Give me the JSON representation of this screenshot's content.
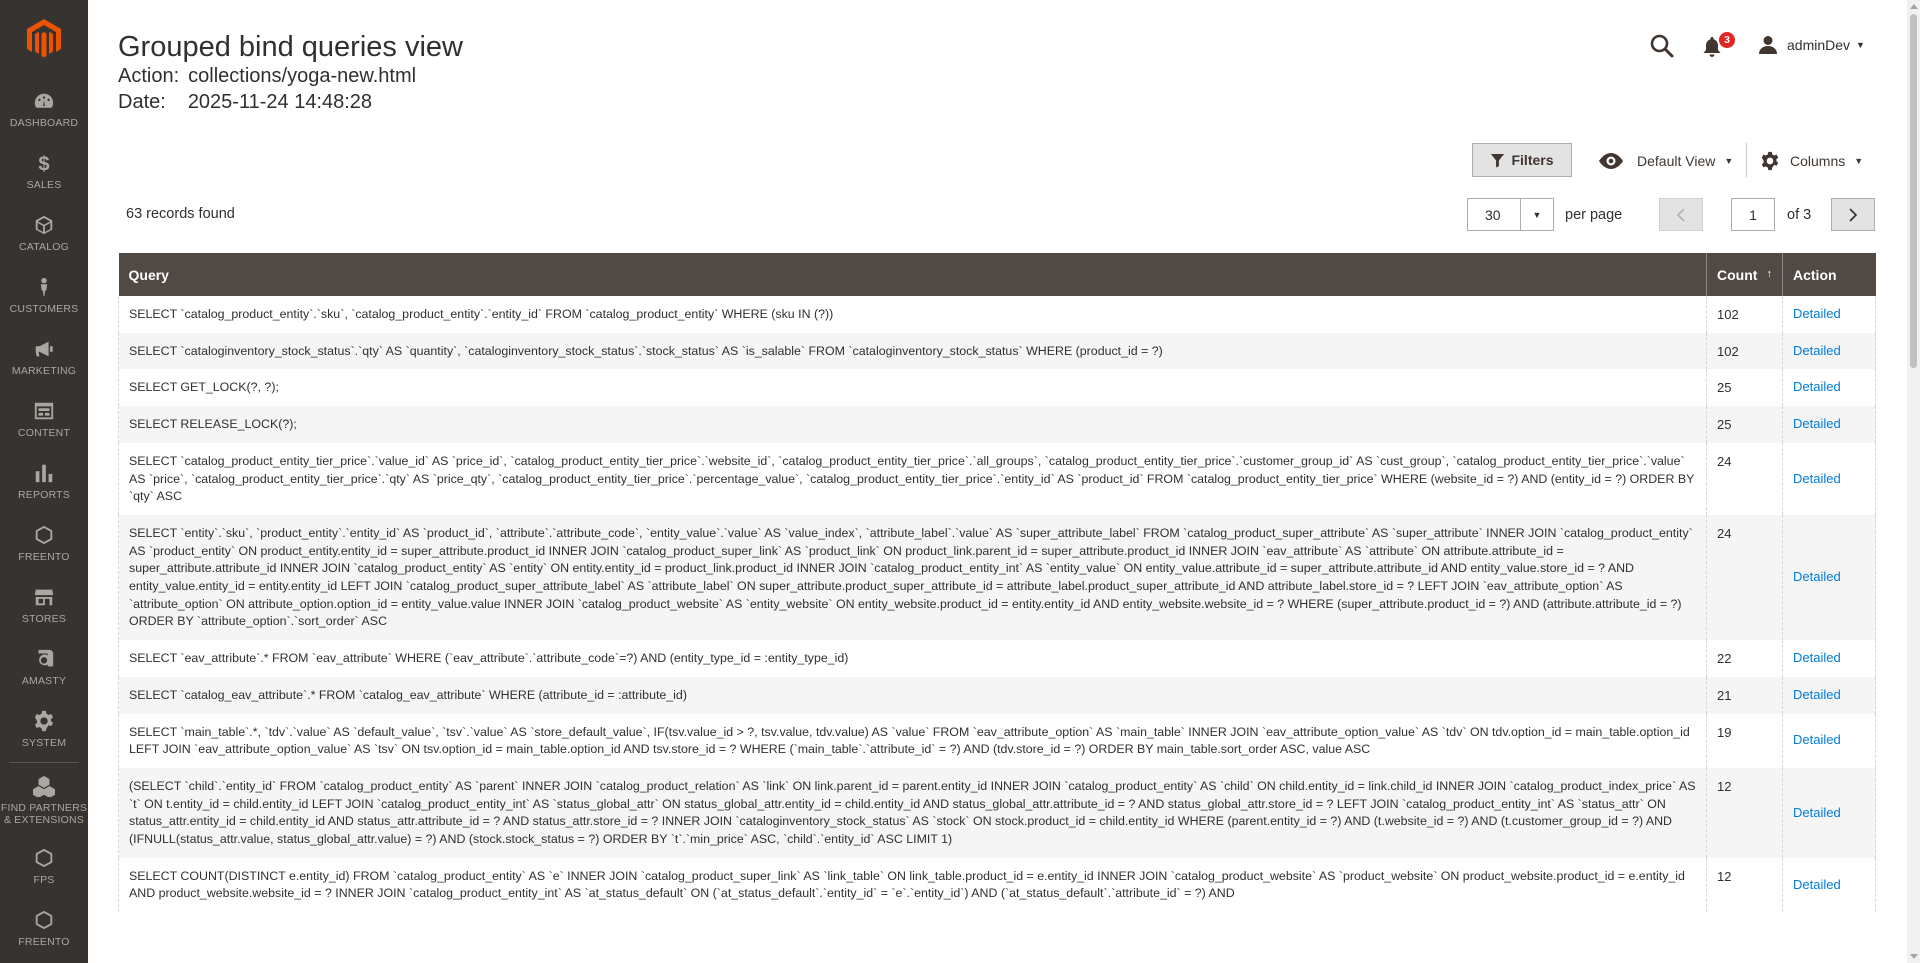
{
  "sidebar": {
    "logo": "magento-logo",
    "items": [
      {
        "label": "DASHBOARD",
        "icon": "dashboard-icon"
      },
      {
        "label": "SALES",
        "icon": "dollar-icon"
      },
      {
        "label": "CATALOG",
        "icon": "cube-icon"
      },
      {
        "label": "CUSTOMERS",
        "icon": "person-icon"
      },
      {
        "label": "MARKETING",
        "icon": "megaphone-icon"
      },
      {
        "label": "CONTENT",
        "icon": "layout-icon"
      },
      {
        "label": "REPORTS",
        "icon": "bar-chart-icon"
      },
      {
        "label": "FREENTO",
        "icon": "hexagon-icon"
      },
      {
        "label": "STORES",
        "icon": "store-icon"
      },
      {
        "label": "AMASTY",
        "icon": "amasty-icon"
      },
      {
        "label": "SYSTEM",
        "icon": "gear-icon"
      },
      {
        "label": "FIND PARTNERS & EXTENSIONS",
        "icon": "boxes-icon"
      },
      {
        "label": "FPS",
        "icon": "hexagon-icon"
      },
      {
        "label": "FREENTO",
        "icon": "hexagon-icon"
      }
    ]
  },
  "header": {
    "title": "Grouped bind queries view",
    "action_label": "Action:",
    "action_value": "collections/yoga-new.html",
    "date_label": "Date:",
    "date_value": "2025-11-24 14:48:28",
    "notifications_count": "3",
    "user_name": "adminDev"
  },
  "toolbar": {
    "filters_label": "Filters",
    "view_label": "Default View",
    "columns_label": "Columns",
    "records_found": "63 records found",
    "per_page_value": "30",
    "per_page_label": "per page",
    "current_page": "1",
    "total_pages_label": "of 3"
  },
  "grid": {
    "columns": [
      "Query",
      "Count",
      "Action"
    ],
    "sort_indicator": "↑",
    "action_link": "Detailed",
    "rows": [
      {
        "query": "SELECT `catalog_product_entity`.`sku`, `catalog_product_entity`.`entity_id` FROM `catalog_product_entity` WHERE (sku IN (?))",
        "count": "102"
      },
      {
        "query": "SELECT `cataloginventory_stock_status`.`qty` AS `quantity`, `cataloginventory_stock_status`.`stock_status` AS `is_salable` FROM `cataloginventory_stock_status` WHERE (product_id = ?)",
        "count": "102"
      },
      {
        "query": "SELECT GET_LOCK(?, ?);",
        "count": "25"
      },
      {
        "query": "SELECT RELEASE_LOCK(?);",
        "count": "25"
      },
      {
        "query": "SELECT `catalog_product_entity_tier_price`.`value_id` AS `price_id`, `catalog_product_entity_tier_price`.`website_id`, `catalog_product_entity_tier_price`.`all_groups`, `catalog_product_entity_tier_price`.`customer_group_id` AS `cust_group`, `catalog_product_entity_tier_price`.`value` AS `price`, `catalog_product_entity_tier_price`.`qty` AS `price_qty`, `catalog_product_entity_tier_price`.`percentage_value`, `catalog_product_entity_tier_price`.`entity_id` AS `product_id` FROM `catalog_product_entity_tier_price` WHERE (website_id = ?) AND (entity_id = ?) ORDER BY `qty` ASC",
        "count": "24"
      },
      {
        "query": "SELECT `entity`.`sku`, `product_entity`.`entity_id` AS `product_id`, `attribute`.`attribute_code`, `entity_value`.`value` AS `value_index`, `attribute_label`.`value` AS `super_attribute_label` FROM `catalog_product_super_attribute` AS `super_attribute` INNER JOIN `catalog_product_entity` AS `product_entity` ON product_entity.entity_id = super_attribute.product_id INNER JOIN `catalog_product_super_link` AS `product_link` ON product_link.parent_id = super_attribute.product_id INNER JOIN `eav_attribute` AS `attribute` ON attribute.attribute_id = super_attribute.attribute_id INNER JOIN `catalog_product_entity` AS `entity` ON entity.entity_id = product_link.product_id INNER JOIN `catalog_product_entity_int` AS `entity_value` ON entity_value.attribute_id = super_attribute.attribute_id AND entity_value.store_id = ? AND entity_value.entity_id = entity.entity_id LEFT JOIN `catalog_product_super_attribute_label` AS `attribute_label` ON super_attribute.product_super_attribute_id = attribute_label.product_super_attribute_id AND attribute_label.store_id = ? LEFT JOIN `eav_attribute_option` AS `attribute_option` ON attribute_option.option_id = entity_value.value INNER JOIN `catalog_product_website` AS `entity_website` ON entity_website.product_id = entity.entity_id AND entity_website.website_id = ? WHERE (super_attribute.product_id = ?) AND (attribute.attribute_id = ?) ORDER BY `attribute_option`.`sort_order` ASC",
        "count": "24"
      },
      {
        "query": "SELECT `eav_attribute`.* FROM `eav_attribute` WHERE (`eav_attribute`.`attribute_code`=?) AND (entity_type_id = :entity_type_id)",
        "count": "22"
      },
      {
        "query": "SELECT `catalog_eav_attribute`.* FROM `catalog_eav_attribute` WHERE (attribute_id = :attribute_id)",
        "count": "21"
      },
      {
        "query": "SELECT `main_table`.*, `tdv`.`value` AS `default_value`, `tsv`.`value` AS `store_default_value`, IF(tsv.value_id > ?, tsv.value, tdv.value) AS `value` FROM `eav_attribute_option` AS `main_table` INNER JOIN `eav_attribute_option_value` AS `tdv` ON tdv.option_id = main_table.option_id LEFT JOIN `eav_attribute_option_value` AS `tsv` ON tsv.option_id = main_table.option_id AND tsv.store_id = ? WHERE (`main_table`.`attribute_id` = ?) AND (tdv.store_id = ?) ORDER BY main_table.sort_order ASC, value ASC",
        "count": "19"
      },
      {
        "query": "(SELECT `child`.`entity_id` FROM `catalog_product_entity` AS `parent` INNER JOIN `catalog_product_relation` AS `link` ON link.parent_id = parent.entity_id INNER JOIN `catalog_product_entity` AS `child` ON child.entity_id = link.child_id INNER JOIN `catalog_product_index_price` AS `t` ON t.entity_id = child.entity_id LEFT JOIN `catalog_product_entity_int` AS `status_global_attr` ON status_global_attr.entity_id = child.entity_id AND status_global_attr.attribute_id = ? AND status_global_attr.store_id = ? LEFT JOIN `catalog_product_entity_int` AS `status_attr` ON status_attr.entity_id = child.entity_id AND status_attr.attribute_id = ? AND status_attr.store_id = ? INNER JOIN `cataloginventory_stock_status` AS `stock` ON stock.product_id = child.entity_id WHERE (parent.entity_id = ?) AND (t.website_id = ?) AND (t.customer_group_id = ?) AND (IFNULL(status_attr.value, status_global_attr.value) = ?) AND (stock.stock_status = ?) ORDER BY `t`.`min_price` ASC, `child`.`entity_id` ASC LIMIT 1)",
        "count": "12"
      },
      {
        "query": "SELECT COUNT(DISTINCT e.entity_id) FROM `catalog_product_entity` AS `e` INNER JOIN `catalog_product_super_link` AS `link_table` ON link_table.product_id = e.entity_id INNER JOIN `catalog_product_website` AS `product_website` ON product_website.product_id = e.entity_id AND product_website.website_id = ? INNER JOIN `catalog_product_entity_int` AS `at_status_default` ON (`at_status_default`.`entity_id` = `e`.`entity_id`) AND (`at_status_default`.`attribute_id` = ?) AND",
        "count": "12"
      }
    ]
  },
  "colors": {
    "sidebar_bg": "#373330",
    "header_bg": "#514943",
    "logo_orange": "#eb5202",
    "link_blue": "#007bdb",
    "badge_red": "#e22626"
  }
}
